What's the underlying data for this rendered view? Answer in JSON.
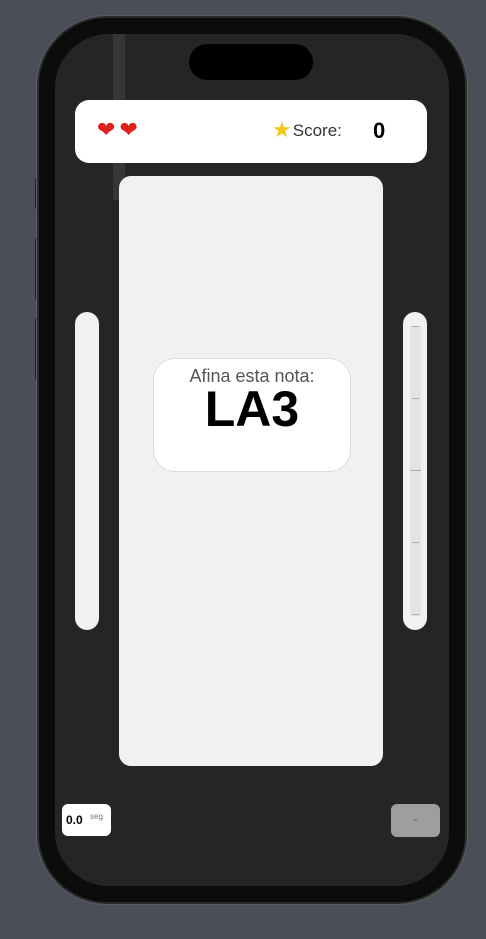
{
  "hud": {
    "lives": [
      {
        "icon": "heart-icon",
        "glyph": "❤"
      },
      {
        "icon": "heart-icon",
        "glyph": "❤"
      }
    ],
    "star_glyph": "★",
    "score_label": "Score:",
    "score_value": "0"
  },
  "prompt": {
    "label": "Afina esta nota:",
    "note": "LA3"
  },
  "timer": {
    "value": "0.0",
    "unit": "seg"
  },
  "action_button": {
    "label": "-"
  },
  "colors": {
    "heart": "#e0201c",
    "star": "#f5c518",
    "background": "#252525",
    "panel": "#f1f1f1"
  }
}
